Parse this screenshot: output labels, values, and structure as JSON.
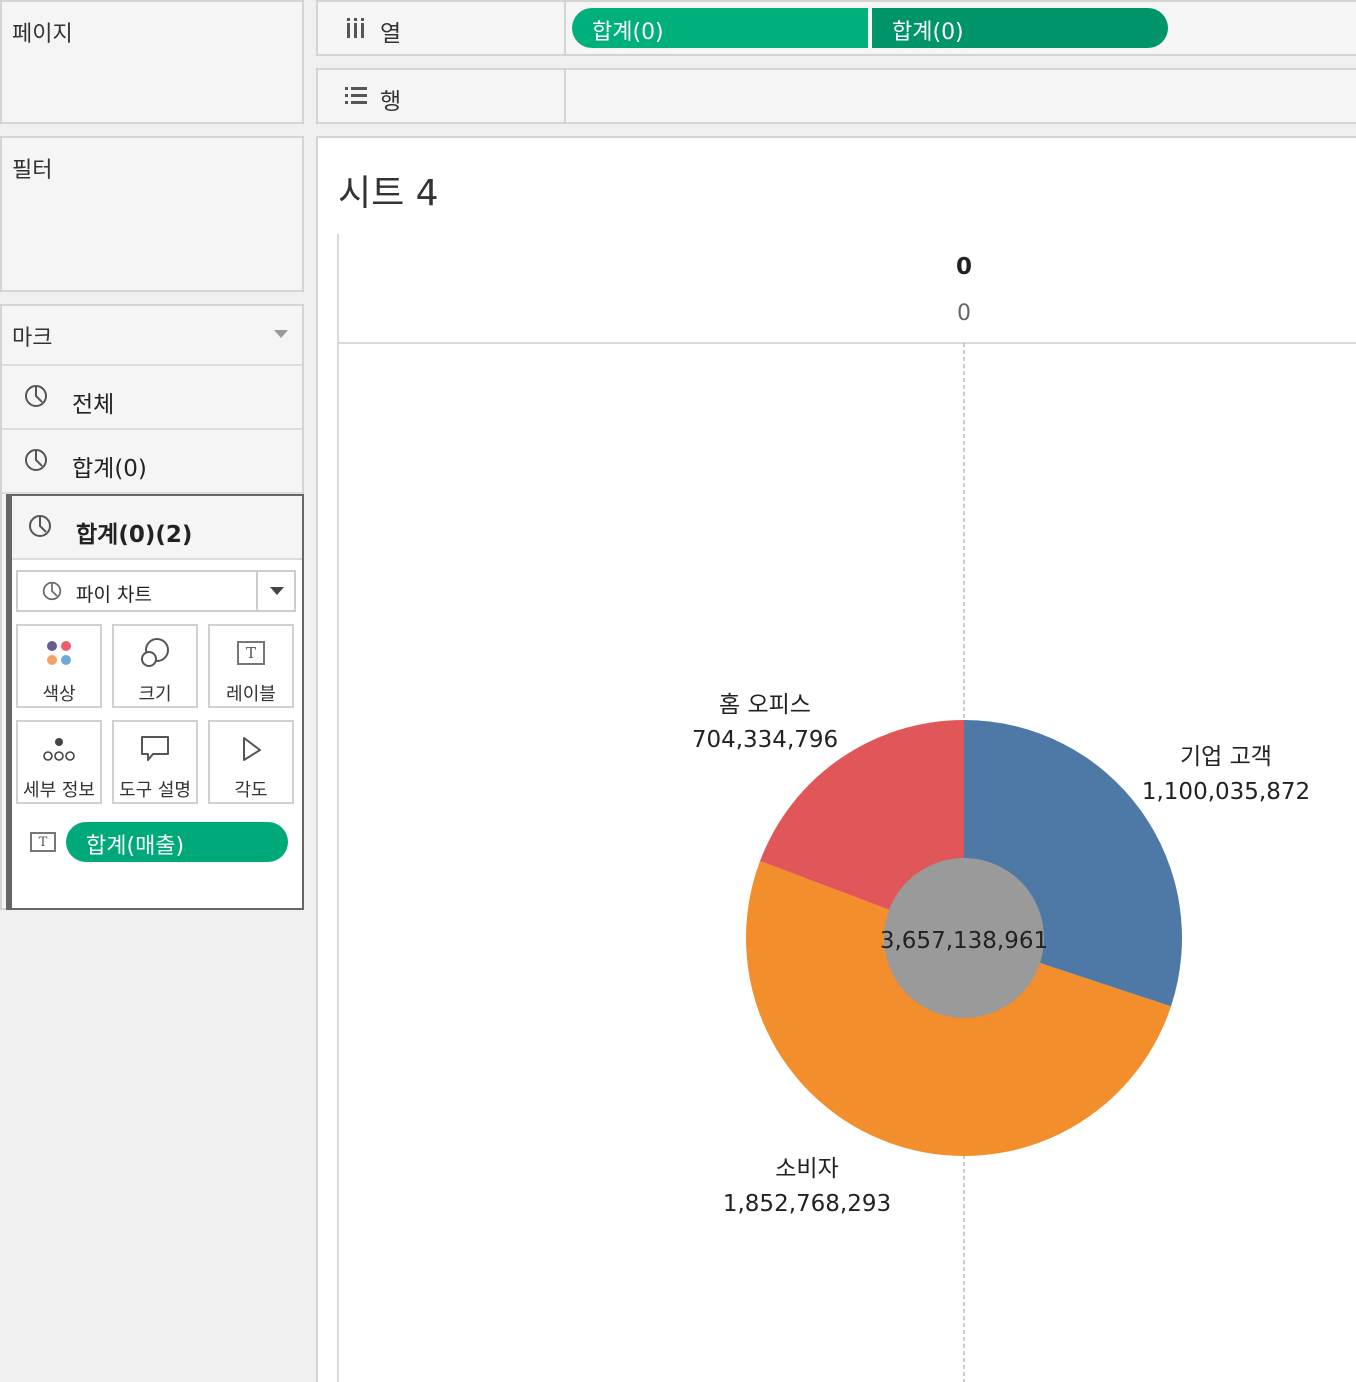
{
  "pages": {
    "title": "페이지"
  },
  "filters": {
    "title": "필터"
  },
  "marks": {
    "title": "마크",
    "rows": [
      {
        "label": "전체"
      },
      {
        "label": "합계(0)"
      },
      {
        "label": "합계(0)(2)"
      }
    ],
    "mark_type": "파이 차트",
    "buttons": [
      {
        "label": "색상",
        "icon": "color-icon"
      },
      {
        "label": "크기",
        "icon": "size-icon"
      },
      {
        "label": "레이블",
        "icon": "label-icon"
      },
      {
        "label": "세부 정보",
        "icon": "detail-icon"
      },
      {
        "label": "도구 설명",
        "icon": "tooltip-icon"
      },
      {
        "label": "각도",
        "icon": "angle-icon"
      }
    ],
    "field_pill": {
      "label": "합계(매출)",
      "color": "#00a97a"
    }
  },
  "columns_shelf": {
    "label": "열",
    "pills": [
      {
        "label": "합계(0)",
        "color": "#00b07c"
      },
      {
        "label": "합계(0)",
        "color": "#00946a"
      }
    ]
  },
  "rows_shelf": {
    "label": "행"
  },
  "view": {
    "sheet_title": "시트 4"
  },
  "chart_data": {
    "type": "pie",
    "subtype": "donut",
    "header_title": "0",
    "axis_tick": "0",
    "total_label": "3,657,138,961",
    "hole_color": "#9a9a9a",
    "slices": [
      {
        "label": "기업 고객",
        "value": 1100035872,
        "value_label": "1,100,035,872",
        "color": "#4e79a7"
      },
      {
        "label": "소비자",
        "value": 1852768293,
        "value_label": "1,852,768,293",
        "color": "#f28e2b"
      },
      {
        "label": "홈 오피스",
        "value": 704334796,
        "value_label": "704,334,796",
        "color": "#e15759"
      }
    ]
  }
}
